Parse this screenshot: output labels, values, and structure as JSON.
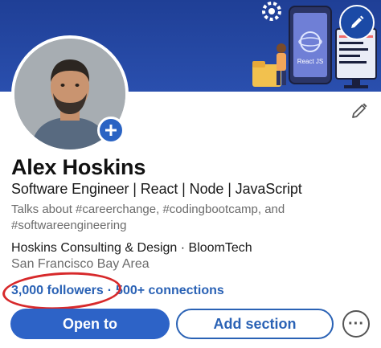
{
  "profile": {
    "name": "Alex Hoskins",
    "headline": "Software Engineer | React | Node | JavaScript",
    "talks_about": "Talks about #careerchange, #codingbootcamp, and #softwareengineering",
    "company_line": "Hoskins Consulting & Design · BloomTech",
    "location": "San Francisco Bay Area"
  },
  "network": {
    "followers": "3,000 followers",
    "separator": "·",
    "connections": "500+ connections"
  },
  "banner": {
    "phone_label": "React JS"
  },
  "actions": {
    "open_to": "Open to",
    "add_section": "Add section",
    "more": "···"
  },
  "colors": {
    "banner": "#2a4fae",
    "primary": "#2d63c7",
    "link": "#2a62b5",
    "annotation": "#d7292b"
  },
  "icons": {
    "edit_banner": "pencil-icon",
    "edit_intro": "pencil-icon",
    "add_photo": "plus-icon",
    "more": "ellipsis-icon"
  }
}
